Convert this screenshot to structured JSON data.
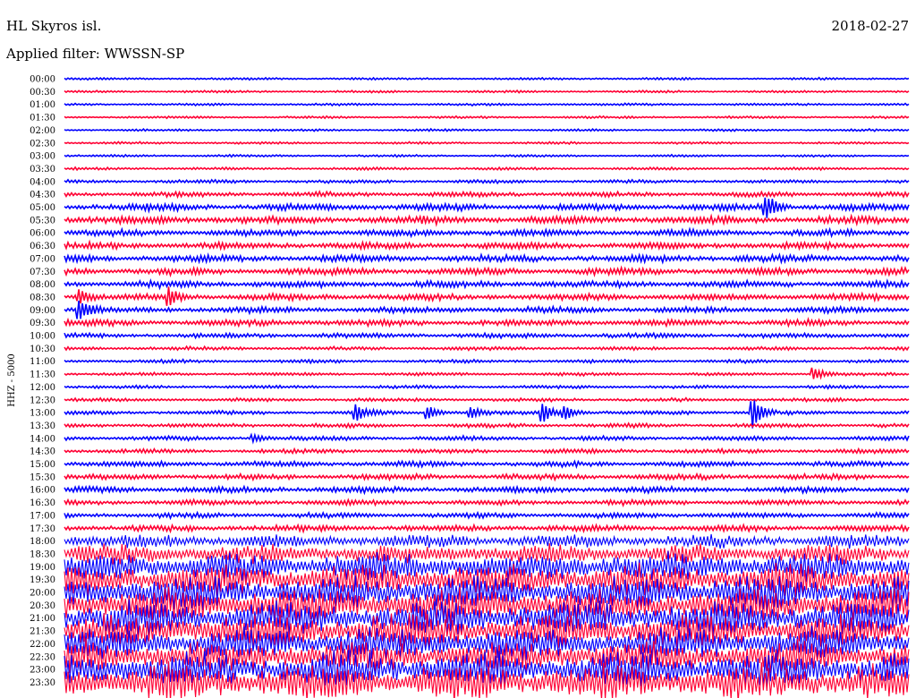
{
  "header": {
    "station": "HL Skyros isl.",
    "date": "2018-02-27",
    "filter": "Applied filter: WWSSN-SP"
  },
  "chart_data": {
    "type": "line",
    "title": "HL Skyros isl.",
    "ylabel": "HHZ - 5000",
    "colors": [
      "#0000ff",
      "#ff0033"
    ],
    "rows": [
      {
        "label": "00:00",
        "noise": 1.0
      },
      {
        "label": "00:30",
        "noise": 1.0
      },
      {
        "label": "01:00",
        "noise": 1.0
      },
      {
        "label": "01:30",
        "noise": 1.0
      },
      {
        "label": "02:00",
        "noise": 1.0
      },
      {
        "label": "02:30",
        "noise": 1.0
      },
      {
        "label": "03:00",
        "noise": 1.0
      },
      {
        "label": "03:30",
        "noise": 1.2
      },
      {
        "label": "04:00",
        "noise": 1.5
      },
      {
        "label": "04:30",
        "noise": 2.2
      },
      {
        "label": "05:00",
        "noise": 3.2
      },
      {
        "label": "05:30",
        "noise": 3.5
      },
      {
        "label": "06:00",
        "noise": 3.0
      },
      {
        "label": "06:30",
        "noise": 3.0
      },
      {
        "label": "07:00",
        "noise": 3.2
      },
      {
        "label": "07:30",
        "noise": 3.2
      },
      {
        "label": "08:00",
        "noise": 3.0
      },
      {
        "label": "08:30",
        "noise": 3.0
      },
      {
        "label": "09:00",
        "noise": 2.8
      },
      {
        "label": "09:30",
        "noise": 2.8
      },
      {
        "label": "10:00",
        "noise": 2.2
      },
      {
        "label": "10:30",
        "noise": 1.6
      },
      {
        "label": "11:00",
        "noise": 1.5
      },
      {
        "label": "11:30",
        "noise": 1.4
      },
      {
        "label": "12:00",
        "noise": 1.4
      },
      {
        "label": "12:30",
        "noise": 1.5
      },
      {
        "label": "13:00",
        "noise": 1.8
      },
      {
        "label": "13:30",
        "noise": 1.8
      },
      {
        "label": "14:00",
        "noise": 2.0
      },
      {
        "label": "14:30",
        "noise": 2.0
      },
      {
        "label": "15:00",
        "noise": 2.4
      },
      {
        "label": "15:30",
        "noise": 2.6
      },
      {
        "label": "16:00",
        "noise": 2.8
      },
      {
        "label": "16:30",
        "noise": 2.4
      },
      {
        "label": "17:00",
        "noise": 2.4
      },
      {
        "label": "17:30",
        "noise": 2.8
      },
      {
        "label": "18:00",
        "noise": 6.0
      },
      {
        "label": "18:30",
        "noise": 9.0
      },
      {
        "label": "19:00",
        "noise": 13.0
      },
      {
        "label": "19:30",
        "noise": 15.0
      },
      {
        "label": "20:00",
        "noise": 16.0
      },
      {
        "label": "20:30",
        "noise": 16.0
      },
      {
        "label": "21:00",
        "noise": 16.0
      },
      {
        "label": "21:30",
        "noise": 16.0
      },
      {
        "label": "22:00",
        "noise": 15.0
      },
      {
        "label": "22:30",
        "noise": 15.0
      },
      {
        "label": "23:00",
        "noise": 16.0
      },
      {
        "label": "23:30",
        "noise": 17.0
      }
    ],
    "events": [
      {
        "row": 10,
        "x": 0.83,
        "amp": 16
      },
      {
        "row": 17,
        "x": 0.123,
        "amp": 10
      },
      {
        "row": 17,
        "x": 0.018,
        "amp": 8
      },
      {
        "row": 18,
        "x": 0.018,
        "amp": 14
      },
      {
        "row": 23,
        "x": 0.887,
        "amp": 8
      },
      {
        "row": 26,
        "x": 0.345,
        "amp": 10
      },
      {
        "row": 26,
        "x": 0.43,
        "amp": 8
      },
      {
        "row": 26,
        "x": 0.48,
        "amp": 7
      },
      {
        "row": 26,
        "x": 0.565,
        "amp": 14
      },
      {
        "row": 26,
        "x": 0.592,
        "amp": 9
      },
      {
        "row": 26,
        "x": 0.815,
        "amp": 18
      },
      {
        "row": 28,
        "x": 0.223,
        "amp": 5
      }
    ]
  }
}
